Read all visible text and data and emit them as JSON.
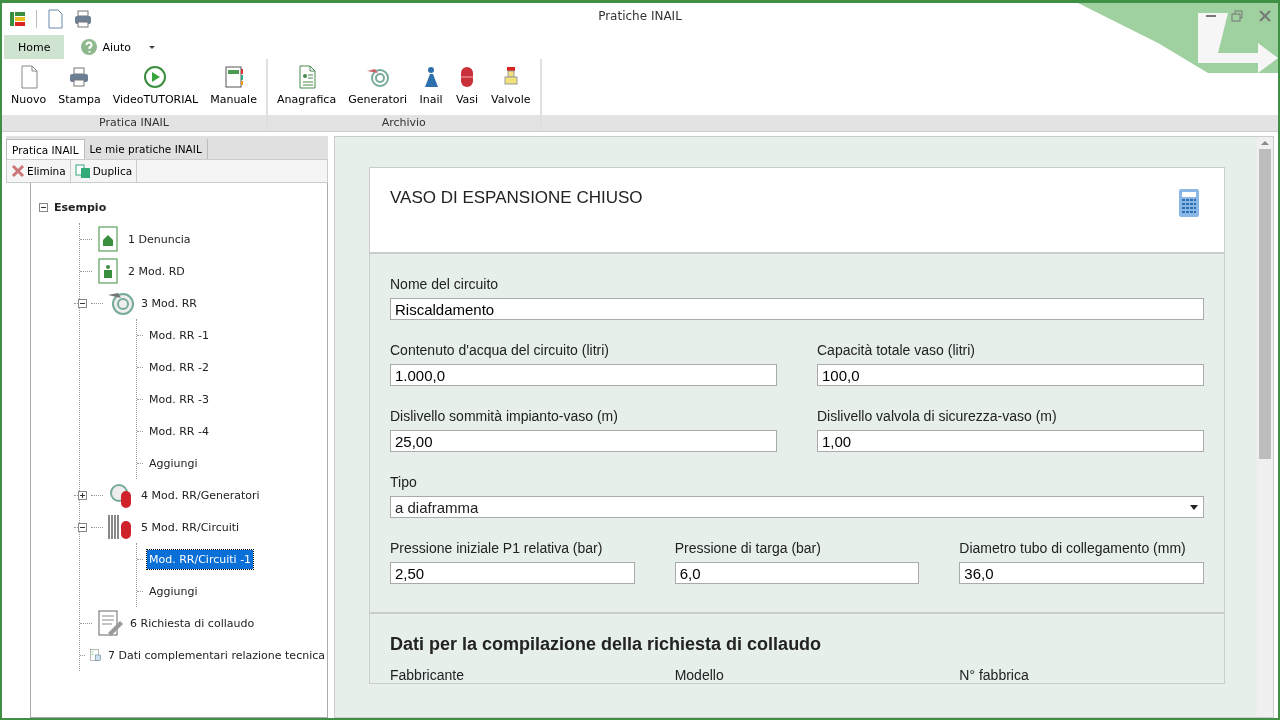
{
  "window": {
    "title": "Pratiche INAIL"
  },
  "menu": [
    {
      "label": "Home",
      "selected": true
    },
    {
      "label": "Aiuto",
      "selected": false
    }
  ],
  "ribbon": [
    {
      "label": "Pratica INAIL",
      "buttons": [
        "Nuovo",
        "Stampa",
        "VideoTUTORIAL",
        "Manuale"
      ]
    },
    {
      "label": "Archivio",
      "buttons": [
        "Anagrafica",
        "Generatori",
        "Inail",
        "Vasi",
        "Valvole"
      ]
    }
  ],
  "panel_tabs": [
    {
      "label": "Pratica INAIL",
      "selected": true
    },
    {
      "label": "Le mie pratiche INAIL",
      "selected": false
    }
  ],
  "panel_toolbar": [
    "Elimina",
    "Duplica"
  ],
  "tree": {
    "label": "Esempio",
    "expanded": true,
    "children": [
      {
        "label": "1 Denuncia",
        "selected": false
      },
      {
        "label": "2 Mod. RD",
        "selected": false
      },
      {
        "label": "3 Mod. RR",
        "selected": false,
        "expanded": true,
        "children": [
          {
            "label": "Mod. RR -1",
            "selected": false
          },
          {
            "label": "Mod. RR -2",
            "selected": false
          },
          {
            "label": "Mod. RR -3",
            "selected": false
          },
          {
            "label": "Mod. RR -4",
            "selected": false
          },
          {
            "label": "Aggiungi",
            "selected": false
          }
        ]
      },
      {
        "label": "4 Mod. RR/Generatori",
        "selected": false,
        "expanded": false
      },
      {
        "label": "5 Mod. RR/Circuiti",
        "selected": false,
        "expanded": true,
        "children": [
          {
            "label": "Mod. RR/Circuiti -1",
            "selected": true
          },
          {
            "label": "Aggiungi",
            "selected": false
          }
        ]
      },
      {
        "label": "6 Richiesta di collaudo",
        "selected": false
      },
      {
        "label": "7 Dati complementari relazione tecnica",
        "selected": false
      }
    ]
  },
  "form": {
    "title": "VASO DI ESPANSIONE CHIUSO",
    "rows": [
      [
        {
          "label": "Nome del circuito",
          "value": "Riscaldamento",
          "kind": "input"
        }
      ],
      [
        {
          "label": "Contenuto d'acqua del circuito (litri)",
          "value": "1.000,0",
          "kind": "input"
        },
        {
          "label": "Capacità totale vaso (litri)",
          "value": "100,0",
          "kind": "input"
        }
      ],
      [
        {
          "label": "Dislivello sommità impianto-vaso (m)",
          "value": "25,00",
          "kind": "input"
        },
        {
          "label": "Dislivello valvola di sicurezza-vaso (m)",
          "value": "1,00",
          "kind": "input"
        }
      ],
      [
        {
          "label": "Tipo",
          "value": "a diaframma",
          "kind": "select"
        }
      ],
      [
        {
          "label": "Pressione iniziale P1 relativa (bar)",
          "value": "2,50",
          "kind": "input"
        },
        {
          "label": "Pressione di targa (bar)",
          "value": "6,0",
          "kind": "input"
        },
        {
          "label": "Diametro tubo di collegamento (mm)",
          "value": "36,0",
          "kind": "input"
        }
      ]
    ],
    "section": {
      "title": "Dati per la compilazione della richiesta di collaudo",
      "labels": [
        "Fabbricante",
        "Modello",
        "N° fabbrica"
      ]
    }
  }
}
